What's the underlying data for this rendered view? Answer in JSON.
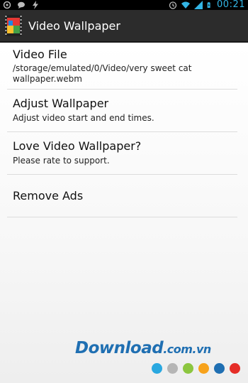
{
  "status_bar": {
    "time": "00:21",
    "left_icons": [
      "android-debug-icon",
      "chat-bubble-icon",
      "flash-icon"
    ],
    "right_icons": [
      "alarm-icon",
      "wifi-icon",
      "signal-icon",
      "battery-charging-icon"
    ],
    "time_color": "#33b5e5"
  },
  "action_bar": {
    "title": "Video Wallpaper",
    "icon": "film-strip-icon"
  },
  "preferences": [
    {
      "title": "Video File",
      "summary": "/storage/emulated/0/Video/very sweet cat wallpaper.webm"
    },
    {
      "title": "Adjust Wallpaper",
      "summary": "Adjust video start and end times."
    },
    {
      "title": "Love Video Wallpaper?",
      "summary": "Please rate to support."
    },
    {
      "title": "Remove Ads",
      "summary": ""
    }
  ],
  "watermark": {
    "brand": "Download",
    "domain": ".com.vn",
    "dot_colors": [
      "#29a8e0",
      "#b5b5b5",
      "#8cc63f",
      "#f7a21b",
      "#1f6fb2",
      "#e52d27"
    ]
  }
}
